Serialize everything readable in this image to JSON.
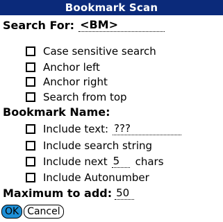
{
  "window": {
    "title": "Bookmark Scan"
  },
  "search": {
    "label": "Search For:",
    "value": "<BM>"
  },
  "search_options": [
    {
      "label": "Case sensitive search",
      "checked": false
    },
    {
      "label": "Anchor left",
      "checked": false
    },
    {
      "label": "Anchor right",
      "checked": false
    },
    {
      "label": "Search from top",
      "checked": false
    }
  ],
  "bookmark_name": {
    "label": "Bookmark Name:",
    "include_text": {
      "label": "Include text:",
      "value": "???",
      "checked": false
    },
    "include_search_string": {
      "label": "Include search string",
      "checked": false
    },
    "include_next": {
      "label": "Include next",
      "value": "5",
      "suffix": "chars",
      "checked": false
    },
    "include_autonumber": {
      "label": "Include Autonumber",
      "checked": false
    }
  },
  "maximum": {
    "label": "Maximum to add:",
    "value": "50"
  },
  "buttons": {
    "ok_label": "OK",
    "cancel_label": "Cancel"
  }
}
